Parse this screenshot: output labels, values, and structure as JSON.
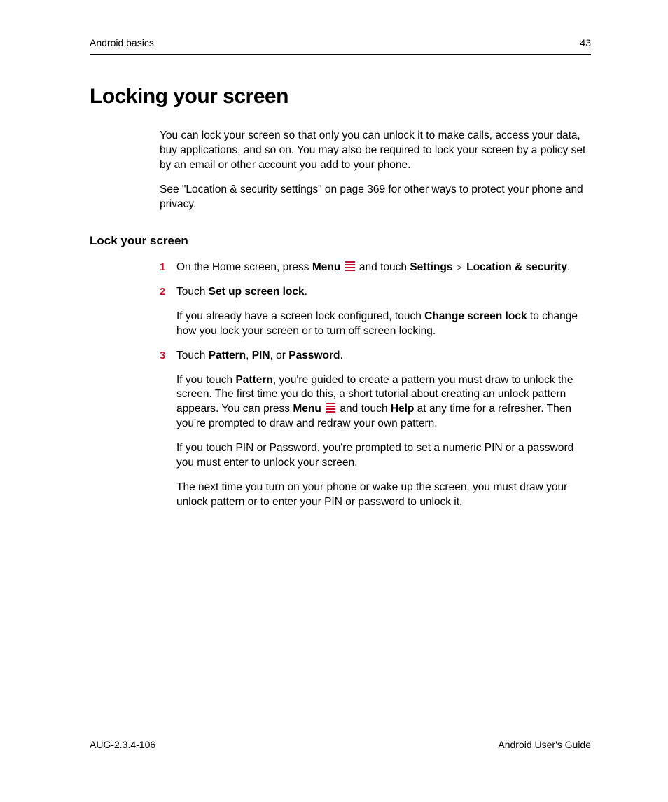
{
  "header": {
    "left": "Android basics",
    "right": "43"
  },
  "title": "Locking your screen",
  "intro": {
    "p1": "You can lock your screen so that only you can unlock it to make calls, access your data, buy applications, and so on. You may also be required to lock your screen by a policy set by an email or other account you add to your phone.",
    "p2": "See \"Location & security settings\" on page 369 for other ways to protect your phone and privacy."
  },
  "section_title": "Lock your screen",
  "steps": [
    {
      "num": "1",
      "line_pre": "On the Home screen, press ",
      "menu_word": "Menu",
      "line_mid": " and touch ",
      "settings_word": "Settings",
      "chev": ">",
      "loc_sec_word": "Location & security",
      "line_end": "."
    },
    {
      "num": "2",
      "line_pre": "Touch ",
      "bold1": "Set up screen lock",
      "line_end": ".",
      "sub_pre": "If you already have a screen lock configured, touch ",
      "sub_bold": "Change screen lock",
      "sub_post": " to change how you lock your screen or to turn off screen locking."
    },
    {
      "num": "3",
      "line_pre": "Touch ",
      "bold1": "Pattern",
      "sep1": ", ",
      "bold2": "PIN",
      "sep2": ", or ",
      "bold3": "Password",
      "line_end": ".",
      "p2_pre": "If you touch ",
      "p2_bold1": "Pattern",
      "p2_mid1": ", you're guided to create a pattern you must draw to unlock the screen. The first time you do this, a short tutorial about creating an unlock pattern appears. You can press ",
      "p2_menu": "Menu",
      "p2_mid2": " and touch ",
      "p2_bold2": "Help",
      "p2_post": " at any time for a refresher. Then you're prompted to draw and redraw your own pattern.",
      "p3": "If you touch PIN or Password, you're prompted to set a numeric PIN or a password you must enter to unlock your screen.",
      "p4": "The next time you turn on your phone or wake up the screen, you must draw your unlock pattern or to enter your PIN or password to unlock it."
    }
  ],
  "footer": {
    "left": "AUG-2.3.4-106",
    "right": "Android User's Guide"
  }
}
